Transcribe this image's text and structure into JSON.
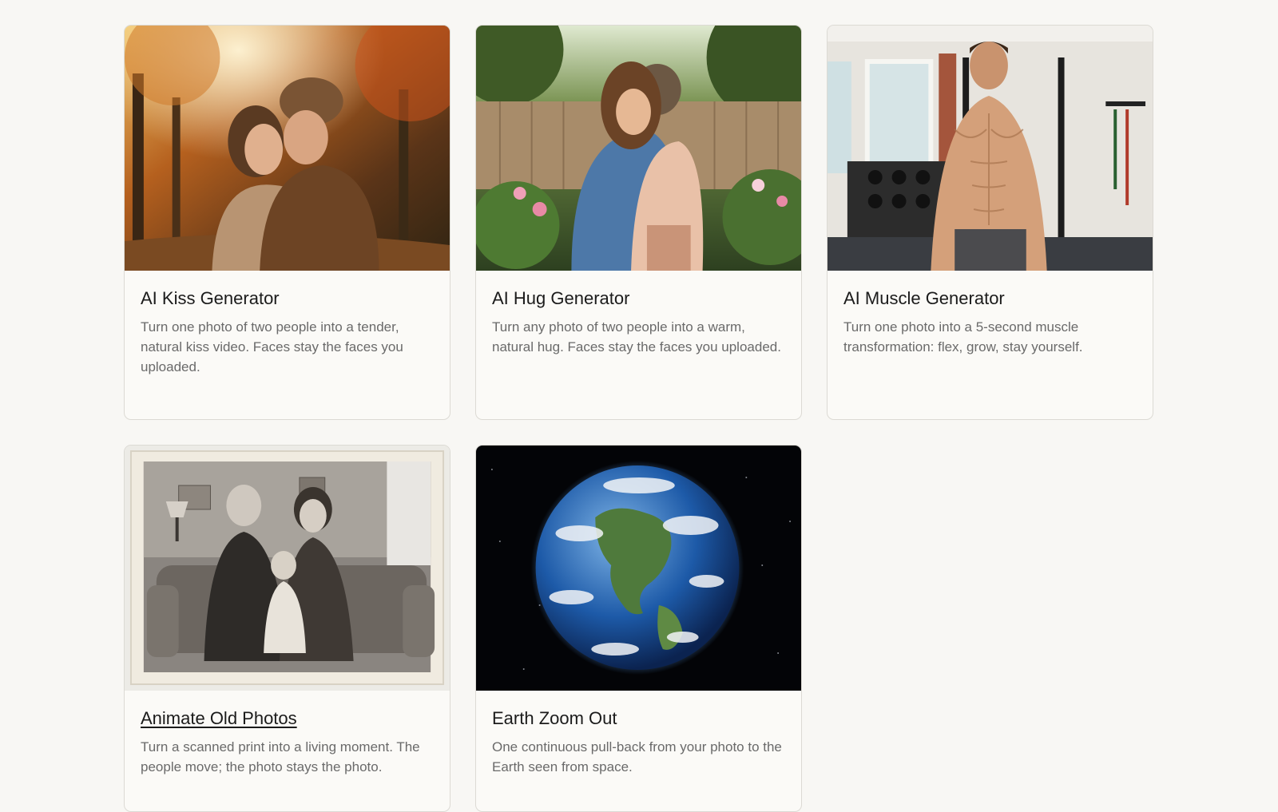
{
  "cards": [
    {
      "title": "AI Kiss Generator",
      "description": "Turn one photo of two people into a tender, natural kiss video. Faces stay the faces you uploaded.",
      "image": "couple-kissing-autumn-park-photo"
    },
    {
      "title": "AI Hug Generator",
      "description": "Turn any photo of two people into a warm, natural hug. Faces stay the faces you uploaded.",
      "image": "couple-hugging-garden-photo"
    },
    {
      "title": "AI Muscle Generator",
      "description": "Turn one photo into a 5-second muscle transformation: flex, grow, stay yourself.",
      "image": "muscular-man-home-gym-photo"
    },
    {
      "title": "Animate Old Photos",
      "description": "Turn a scanned print into a living moment. The people move; the photo stays the photo.",
      "image": "vintage-family-portrait-photo"
    },
    {
      "title": "Earth Zoom Out",
      "description": "One continuous pull-back from your photo to the Earth seen from space.",
      "image": "earth-from-space-photo"
    }
  ]
}
